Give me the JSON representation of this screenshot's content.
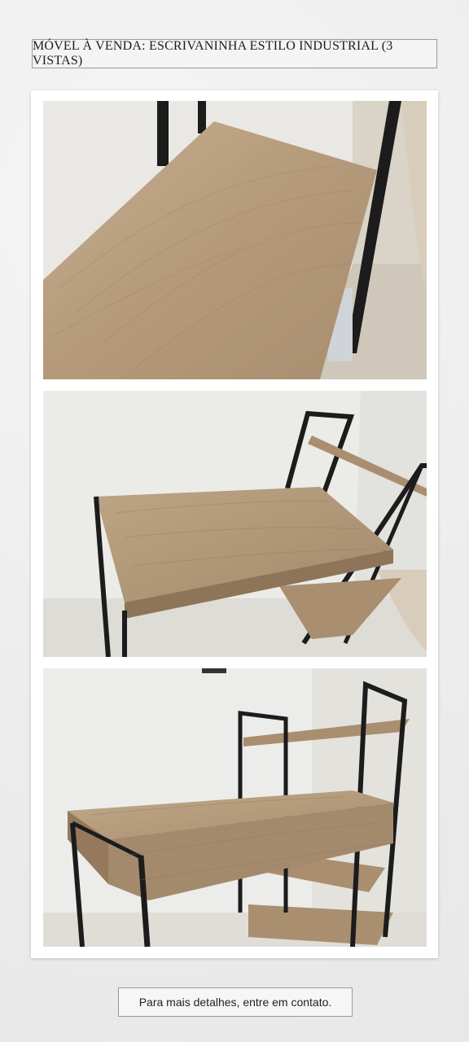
{
  "header": {
    "title": "MÓVEL À VENDA: ESCRIVANINHA ESTILO INDUSTRIAL (3 VISTAS)"
  },
  "footer": {
    "text": "Para mais detalhes, entre em contato."
  },
  "colors": {
    "wood": "#b39a7b",
    "metal": "#1c1c1c",
    "wall": "#ebebe8"
  }
}
